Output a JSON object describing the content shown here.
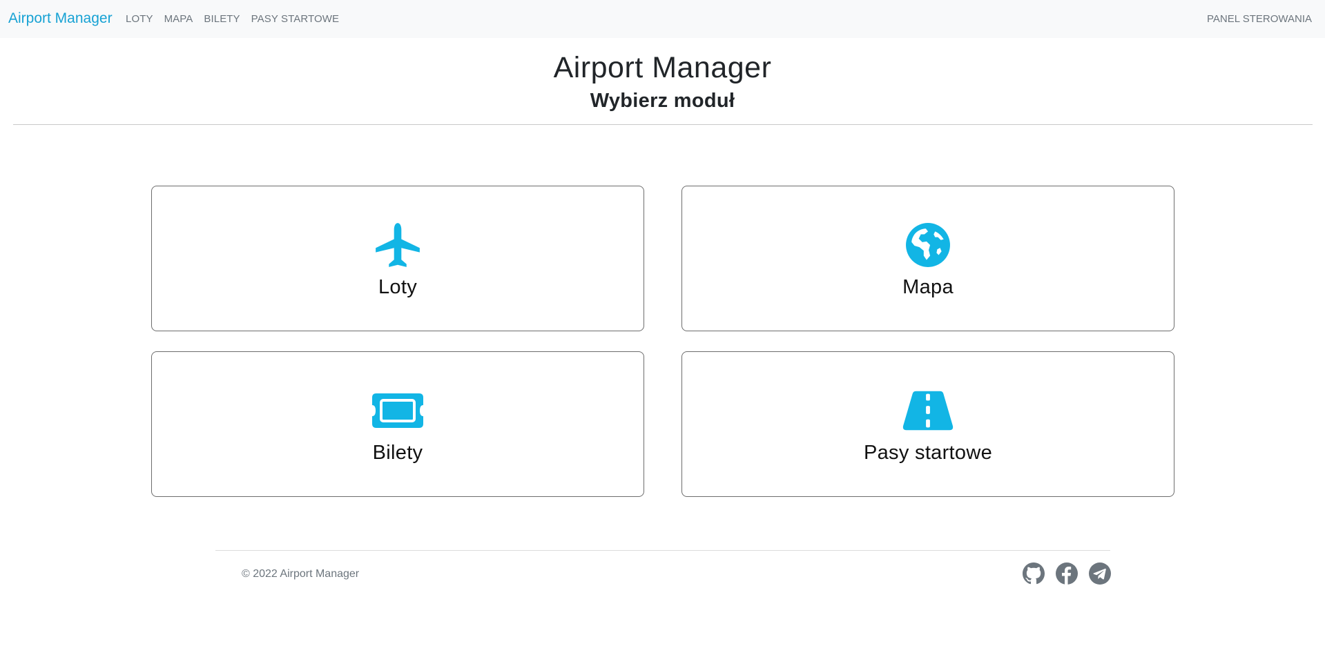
{
  "navbar": {
    "brand": "Airport Manager",
    "links": [
      "LOTY",
      "MAPA",
      "BILETY",
      "PASY STARTOWE"
    ],
    "right_link": "PANEL STEROWANIA"
  },
  "header": {
    "title": "Airport Manager",
    "subtitle": "Wybierz moduł"
  },
  "modules": [
    {
      "label": "Loty",
      "icon": "airplane-icon"
    },
    {
      "label": "Mapa",
      "icon": "globe-icon"
    },
    {
      "label": "Bilety",
      "icon": "ticket-icon"
    },
    {
      "label": "Pasy startowe",
      "icon": "road-icon"
    }
  ],
  "footer": {
    "copyright": "© 2022 Airport Manager",
    "social": [
      "github-icon",
      "facebook-icon",
      "telegram-icon"
    ]
  },
  "colors": {
    "accent": "#17a2d4",
    "icon_blue": "#12b5e5",
    "navbar_bg": "#f8f9fa",
    "muted_text": "#6c757d",
    "social_icon": "#6c757d"
  }
}
